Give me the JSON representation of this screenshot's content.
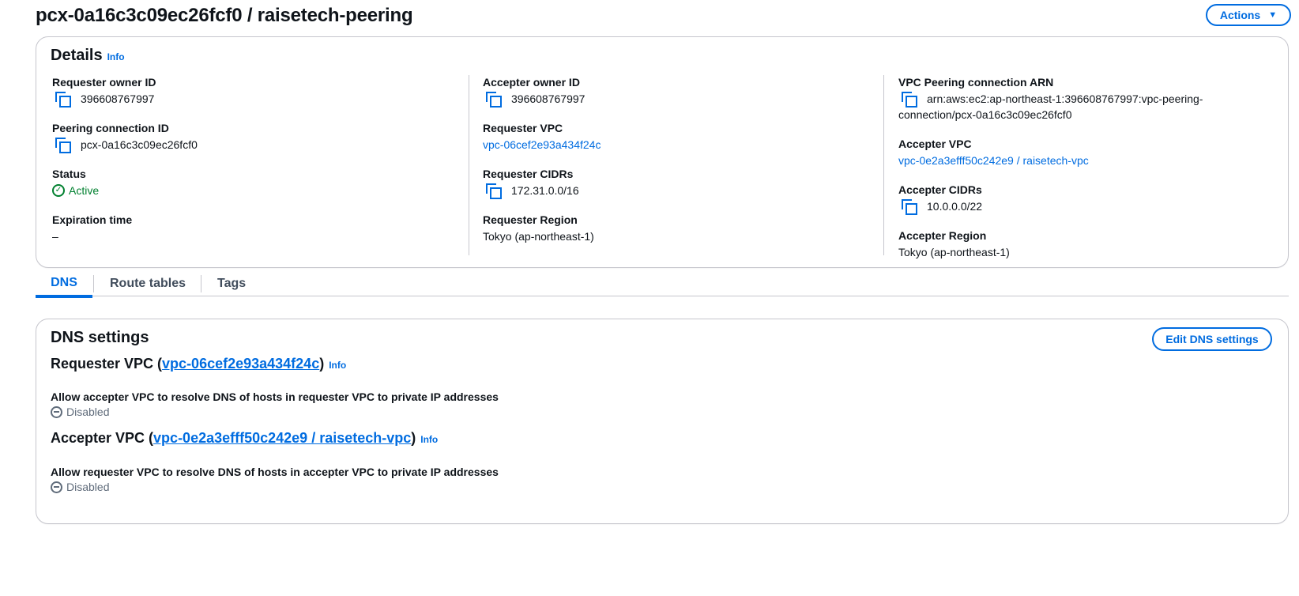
{
  "header": {
    "title": "pcx-0a16c3c09ec26fcf0 / raisetech-peering",
    "actions_label": "Actions",
    "actions_caret": "▼"
  },
  "details": {
    "heading": "Details",
    "info": "Info",
    "requester_owner_id": {
      "label": "Requester owner ID",
      "value": "396608767997"
    },
    "peering_connection_id": {
      "label": "Peering connection ID",
      "value": "pcx-0a16c3c09ec26fcf0"
    },
    "status": {
      "label": "Status",
      "value": "Active",
      "color": "#00802f"
    },
    "expiration_time": {
      "label": "Expiration time",
      "value": "–"
    },
    "accepter_owner_id": {
      "label": "Accepter owner ID",
      "value": "396608767997"
    },
    "requester_vpc": {
      "label": "Requester VPC",
      "value": "vpc-06cef2e93a434f24c"
    },
    "requester_cidrs": {
      "label": "Requester CIDRs",
      "value": "172.31.0.0/16"
    },
    "requester_region": {
      "label": "Requester Region",
      "value": "Tokyo (ap-northeast-1)"
    },
    "arn": {
      "label": "VPC Peering connection ARN",
      "value_line1": "arn:aws:ec2:ap-northeast-1:396608767997:vpc-peering-",
      "value_line2": "connection/pcx-0a16c3c09ec26fcf0"
    },
    "accepter_vpc": {
      "label": "Accepter VPC",
      "value": "vpc-0e2a3efff50c242e9 / raisetech-vpc"
    },
    "accepter_cidrs": {
      "label": "Accepter CIDRs",
      "value": "10.0.0.0/22"
    },
    "accepter_region": {
      "label": "Accepter Region",
      "value": "Tokyo (ap-northeast-1)"
    }
  },
  "tabs": [
    {
      "label": "DNS",
      "active": true
    },
    {
      "label": "Route tables",
      "active": false
    },
    {
      "label": "Tags",
      "active": false
    }
  ],
  "dns": {
    "heading": "DNS settings",
    "edit_label": "Edit DNS settings",
    "requester": {
      "prefix": "Requester VPC (",
      "link": "vpc-06cef2e93a434f24c",
      "suffix": ")",
      "info": "Info",
      "setting_label": "Allow accepter VPC to resolve DNS of hosts in requester VPC to private IP addresses",
      "setting_value": "Disabled"
    },
    "accepter": {
      "prefix": "Accepter VPC (",
      "link": "vpc-0e2a3efff50c242e9 / raisetech-vpc",
      "suffix": ")",
      "info": "Info",
      "setting_label": "Allow requester VPC to resolve DNS of hosts in accepter VPC to private IP addresses",
      "setting_value": "Disabled"
    }
  },
  "colors": {
    "accent": "#006ce0",
    "success": "#00802f",
    "muted": "#5f6b7a"
  }
}
